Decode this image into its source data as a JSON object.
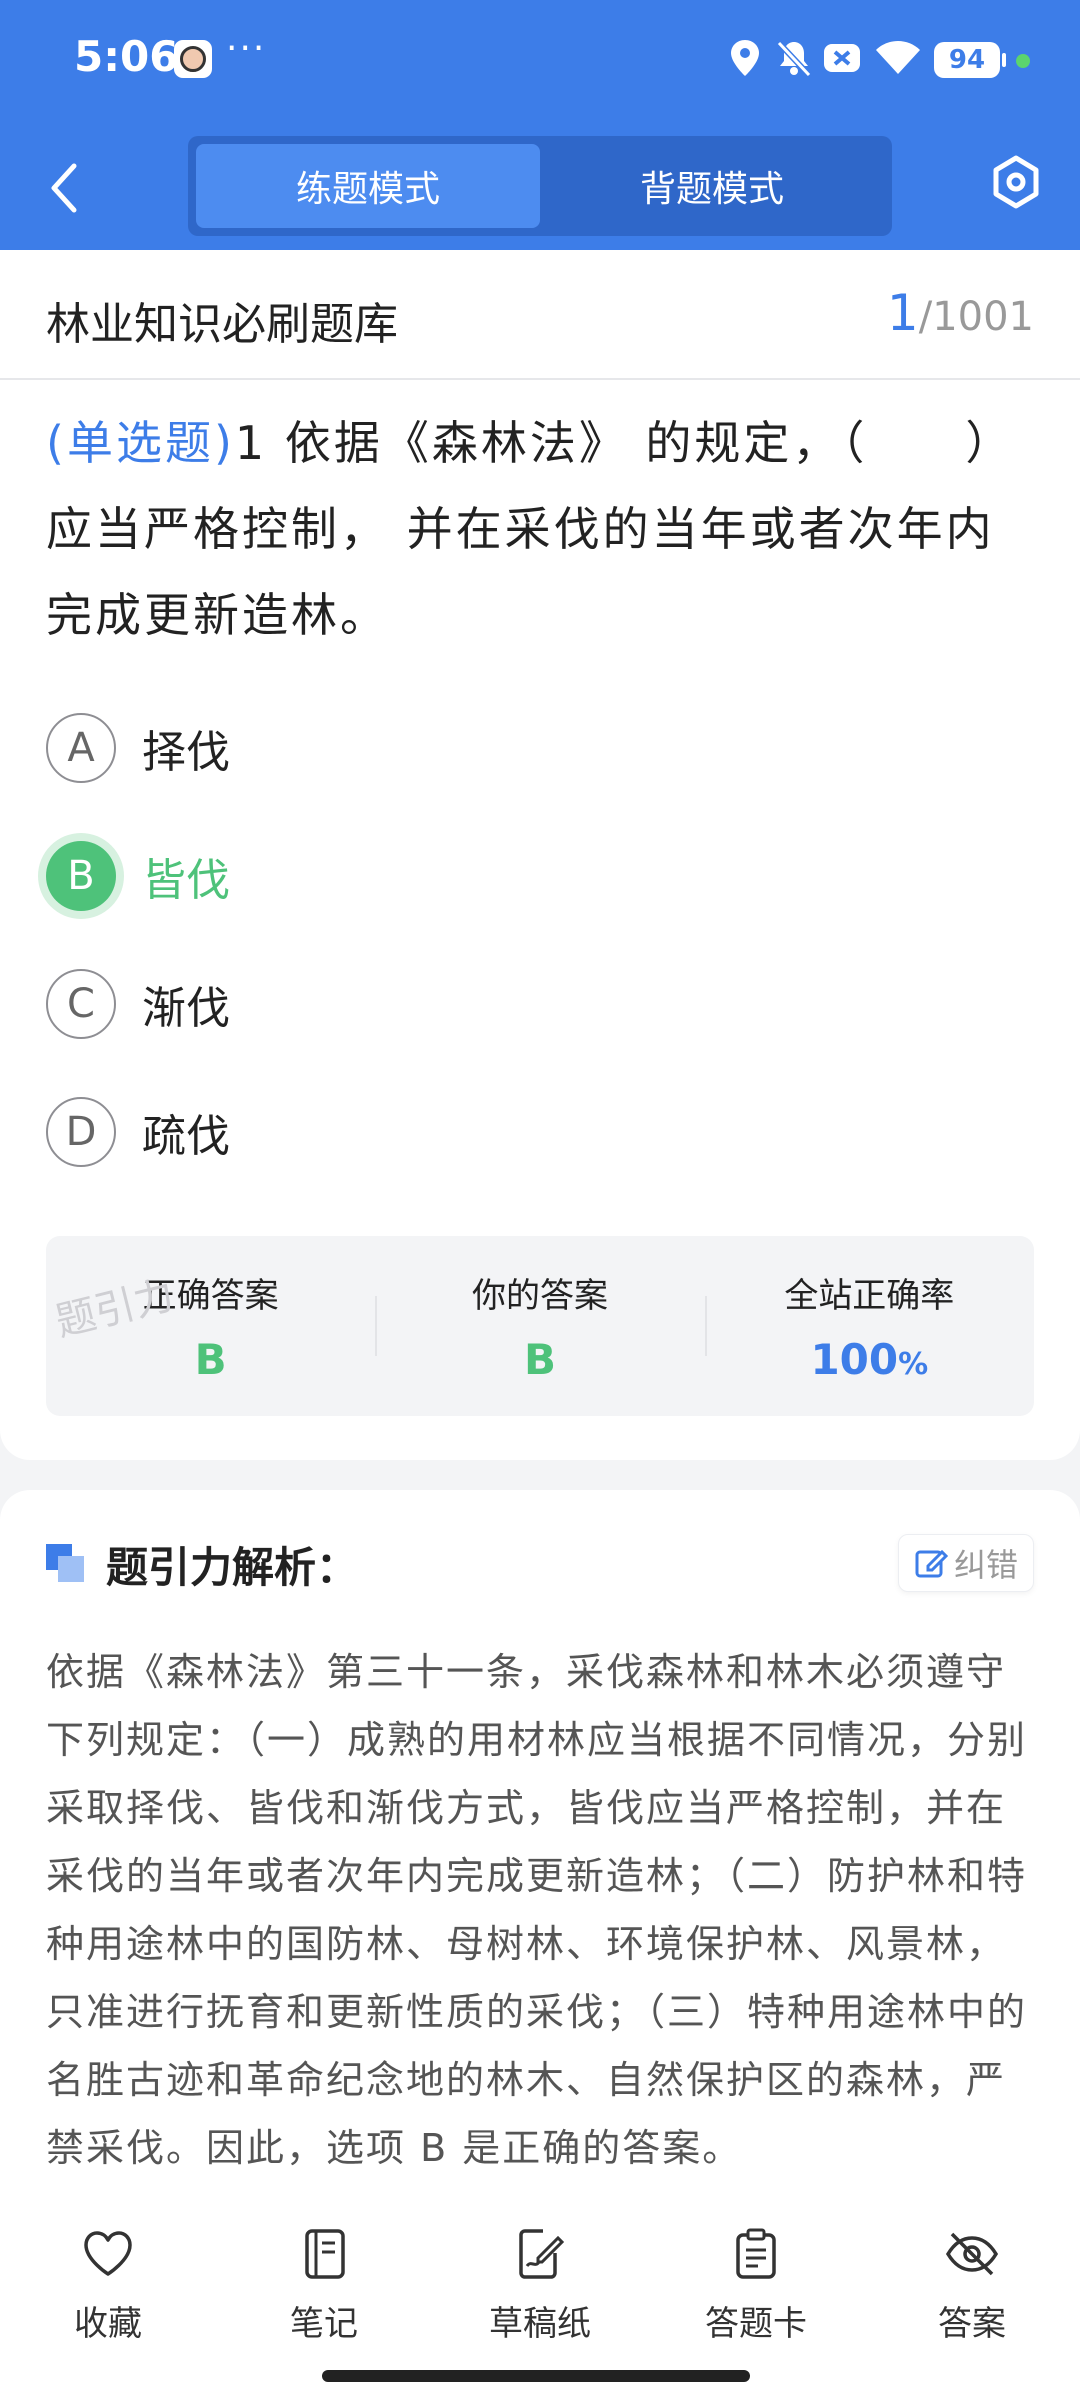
{
  "status": {
    "time": "5:06",
    "dots": "···",
    "battery": "94"
  },
  "nav": {
    "tabs": [
      {
        "label": "练题模式",
        "active": true
      },
      {
        "label": "背题模式",
        "active": false
      }
    ]
  },
  "bank": {
    "name": "林业知识必刷题库",
    "current": "1",
    "total": "/1001"
  },
  "question": {
    "type": "(单选题)",
    "number": "1",
    "text": "依据《森林法》 的规定，（　　）应当严格控制， 并在采伐的当年或者次年内完成更新造林。"
  },
  "options": [
    {
      "letter": "A",
      "text": "择伐",
      "correct": false
    },
    {
      "letter": "B",
      "text": "皆伐",
      "correct": true
    },
    {
      "letter": "C",
      "text": "渐伐",
      "correct": false
    },
    {
      "letter": "D",
      "text": "疏伐",
      "correct": false
    }
  ],
  "stats": {
    "correct_label": "正确答案",
    "correct_value": "B",
    "yours_label": "你的答案",
    "yours_value": "B",
    "rate_label": "全站正确率",
    "rate_value": "100",
    "rate_unit": "%"
  },
  "watermark": "题引力",
  "analysis": {
    "title": "题引力解析：",
    "fix_label": "纠错",
    "text": "依据《森林法》第三十一条，采伐森林和林木必须遵守下列规定：（一）成熟的用材林应当根据不同情况，分别采取择伐、皆伐和渐伐方式，皆伐应当严格控制，并在采伐的当年或者次年内完成更新造林；（二）防护林和特种用途林中的国防林、母树林、环境保护林、风景林，只准进行抚育和更新性质的采伐；（三）特种用途林中的名胜古迹和革命纪念地的林木、自然保护区的森林，严禁采伐。因此，选项 B 是正确的答案。"
  },
  "bottom_tabs": [
    {
      "label": "收藏",
      "icon": "heart-icon"
    },
    {
      "label": "笔记",
      "icon": "notebook-icon"
    },
    {
      "label": "草稿纸",
      "icon": "draft-icon"
    },
    {
      "label": "答题卡",
      "icon": "clipboard-icon"
    },
    {
      "label": "答案",
      "icon": "eye-off-icon"
    }
  ],
  "colors": {
    "primary": "#3d7de8",
    "correct": "#4ec27a"
  }
}
